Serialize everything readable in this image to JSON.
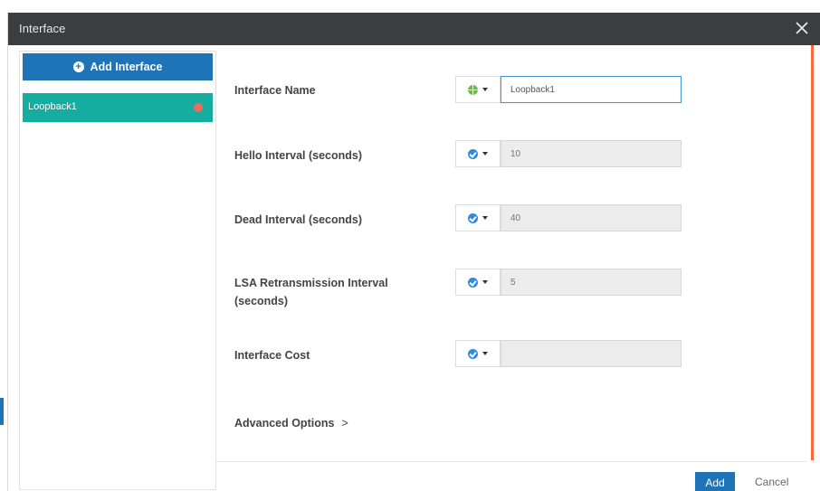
{
  "window": {
    "title": "Interface"
  },
  "sidebar": {
    "add_button_label": "Add Interface",
    "items": [
      {
        "label": "Loopback1",
        "status_color": "#ec6a62"
      }
    ]
  },
  "form": {
    "fields": [
      {
        "label": "Interface Name",
        "mode_icon": "globe-icon",
        "value": "Loopback1",
        "editable": true
      },
      {
        "label": "Hello Interval (seconds)",
        "mode_icon": "check-icon",
        "placeholder": "10"
      },
      {
        "label": "Dead Interval (seconds)",
        "mode_icon": "check-icon",
        "placeholder": "40"
      },
      {
        "label_line1": "LSA Retransmission Interval",
        "label_line2": "(seconds)",
        "mode_icon": "check-icon",
        "placeholder": "5"
      },
      {
        "label": "Interface Cost",
        "mode_icon": "check-icon",
        "placeholder": ""
      }
    ],
    "advanced_label": "Advanced Options",
    "advanced_chevron": ">"
  },
  "footer": {
    "add_label": "Add",
    "cancel_label": "Cancel"
  },
  "colors": {
    "primary": "#1f73b7",
    "selected_item": "#15ada0",
    "accent": "#ff6a3d",
    "titlebar": "#3c3d3f"
  }
}
